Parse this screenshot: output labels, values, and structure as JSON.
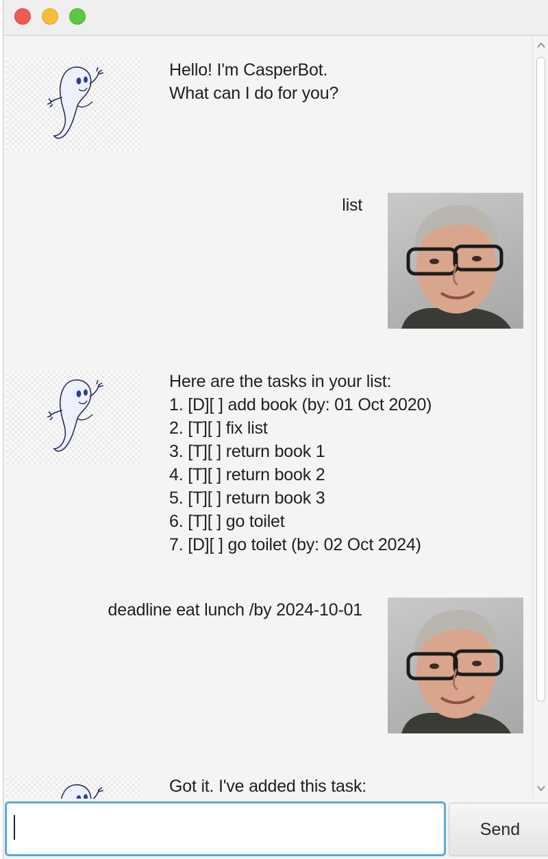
{
  "window": {
    "traffic_lights": {
      "close": "#ee5b51",
      "minimize": "#f5bd3c",
      "maximize": "#5fc545"
    }
  },
  "messages": [
    {
      "sender": "bot",
      "text": "Hello! I'm CasperBot.\nWhat can I do for you?"
    },
    {
      "sender": "user",
      "text": "list"
    },
    {
      "sender": "bot",
      "text": "Here are the tasks in your list:\n1. [D][ ] add book (by: 01 Oct 2020)\n2. [T][ ] fix list\n3. [T][ ] return book 1\n4. [T][ ] return book 2\n5. [T][ ] return book 3\n6. [T][ ] go toilet\n7. [D][ ] go toilet (by: 02 Oct 2024)"
    },
    {
      "sender": "user",
      "text": "deadline eat lunch /by 2024-10-01"
    },
    {
      "sender": "bot",
      "text": "Got it. I've added this task:"
    }
  ],
  "avatars": {
    "bot": "ghost-icon",
    "user": "user-photo"
  },
  "input": {
    "value": "",
    "placeholder": ""
  },
  "send_button": {
    "label": "Send"
  },
  "colors": {
    "input_focus": "#59a8e0",
    "background": "#f4f4f4"
  }
}
